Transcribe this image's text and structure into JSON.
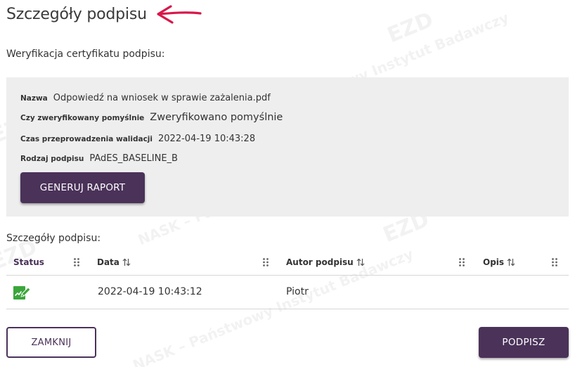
{
  "header": {
    "title": "Szczegóły podpisu",
    "arrow_icon": "red-arrow-icon"
  },
  "verification": {
    "section_label": "Weryfikacja certyfikatu podpisu:",
    "fields": [
      {
        "label": "Nazwa",
        "value": "Odpowiedź na wniosek w sprawie zażalenia.pdf"
      },
      {
        "label": "Czy zweryfikowany pomyślnie",
        "value": "Zweryfikowano pomyślnie"
      },
      {
        "label": "Czas przeprowadzenia walidacji",
        "value": "2022-04-19 10:43:28"
      },
      {
        "label": "Rodzaj podpisu",
        "value": "PAdES_BASELINE_B"
      }
    ],
    "report_button": "GENERUJ RAPORT"
  },
  "signature_table": {
    "section_label": "Szczegóły podpisu:",
    "columns": [
      "Status",
      "Data",
      "Autor podpisu",
      "Opis"
    ],
    "rows": [
      {
        "status_icon": "signature-verified-icon",
        "date": "2022-04-19 10:43:12",
        "author": "Piotr",
        "description": ""
      }
    ]
  },
  "footer": {
    "close_button": "ZAMKNIJ",
    "sign_button": "PODPISZ"
  },
  "colors": {
    "primary": "#4a3259",
    "panel_bg": "#eeeeee",
    "arrow": "#d8174a",
    "status_icon": "#3aa63a"
  }
}
